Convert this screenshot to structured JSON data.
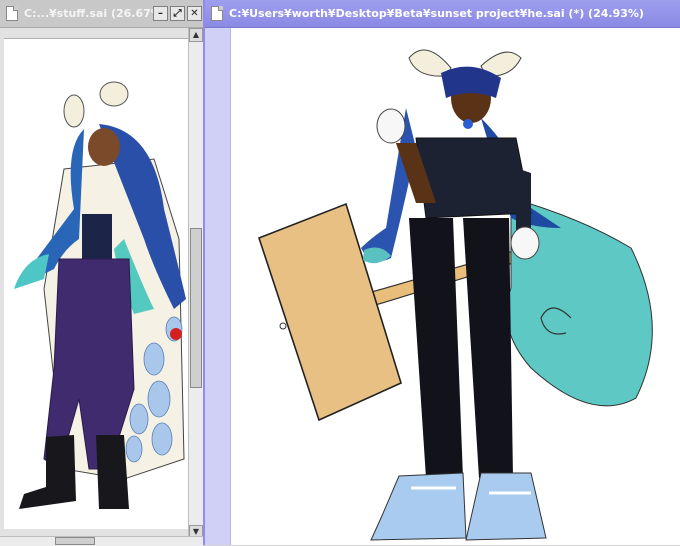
{
  "windows": {
    "left": {
      "title": "C:...¥stuff.sai (26.67%)"
    },
    "right": {
      "title": "C:¥Users¥worth¥Desktop¥Beta¥sunset project¥he.sai (*) (24.93%)"
    }
  },
  "icons": {
    "doc": "document-icon",
    "minimize": "minimize-icon",
    "maximize": "maximize-icon",
    "close": "close-icon",
    "scroll_up": "arrow-up-icon",
    "scroll_down": "arrow-down-icon"
  },
  "colors": {
    "active_titlebar": "#8a8ae4",
    "inactive_titlebar": "#c8c8c8",
    "canvas": "#ffffff"
  }
}
